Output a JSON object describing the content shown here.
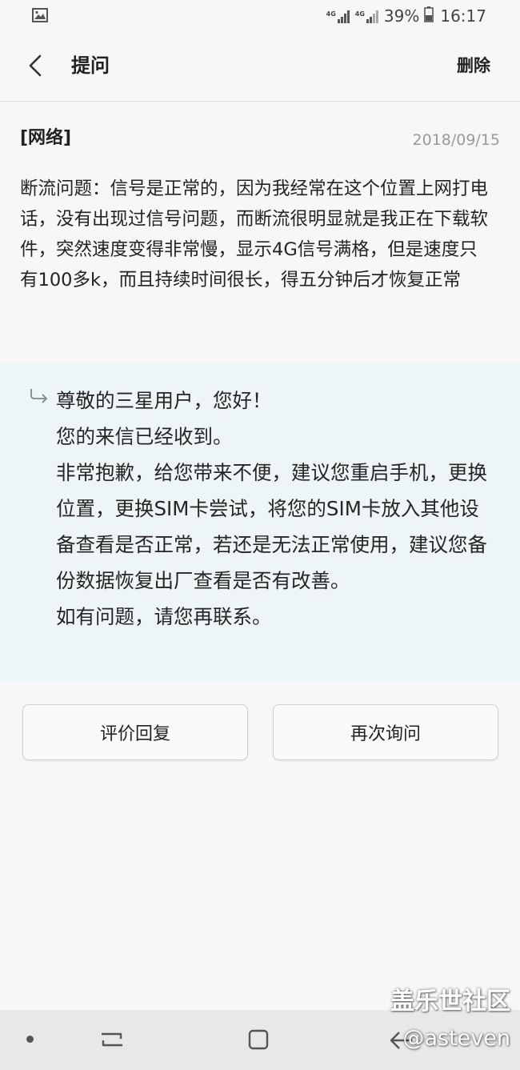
{
  "status_bar": {
    "image_icon": "image-icon",
    "network_1": "4G",
    "network_2": "4G",
    "battery": "39%",
    "time": "16:17"
  },
  "app_bar": {
    "back_icon": "chevron-left-icon",
    "title": "提问",
    "delete_label": "删除"
  },
  "question": {
    "category": "[网络]",
    "date": "2018/09/15",
    "body": "断流问题：信号是正常的，因为我经常在这个位置上网打电话，没有出现过信号问题，而断流很明显就是我正在下载软件，突然速度变得非常慢，显示4G信号满格，但是速度只有100多k，而且持续时间很长，得五分钟后才恢复正常"
  },
  "reply": {
    "icon": "reply-arrow-icon",
    "lines": [
      "尊敬的三星用户，您好！",
      "您的来信已经收到。",
      "非常抱歉，给您带来不便，建议您重启手机，更换位置，更换SIM卡尝试，将您的SIM卡放入其他设备查看是否正常，若还是无法正常使用，建议您备份数据恢复出厂查看是否有改善。",
      "如有问题，请您再联系。"
    ]
  },
  "actions": {
    "rate_label": "评价回复",
    "ask_again_label": "再次询问"
  },
  "nav_bar": {
    "icons": [
      "dot-icon",
      "recents-icon",
      "home-icon",
      "back-icon"
    ]
  },
  "watermark": {
    "community": "盖乐世社区",
    "user": "@asteven"
  }
}
